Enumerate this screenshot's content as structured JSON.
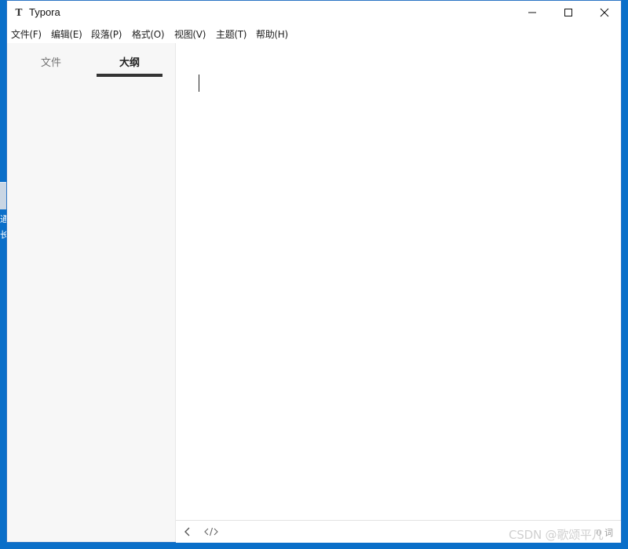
{
  "desktop": {
    "fragment_text": "通\n长"
  },
  "window": {
    "title": "Typora",
    "icon_glyph": "T",
    "controls": {
      "minimize_icon": "minimize-icon",
      "maximize_icon": "maximize-icon",
      "close_icon": "close-icon"
    }
  },
  "menu": {
    "items": [
      {
        "label": "文件(F)"
      },
      {
        "label": "编辑(E)"
      },
      {
        "label": "段落(P)"
      },
      {
        "label": "格式(O)"
      },
      {
        "label": "视图(V)"
      },
      {
        "label": "主题(T)"
      },
      {
        "label": "帮助(H)"
      }
    ]
  },
  "sidebar": {
    "tabs": [
      {
        "label": "文件",
        "active": false
      },
      {
        "label": "大纲",
        "active": true
      }
    ]
  },
  "editor": {
    "content": ""
  },
  "footer": {
    "back_icon": "chevron-left-icon",
    "source_icon": "code-icon",
    "word_count": "0 词"
  },
  "watermark": {
    "text": "CSDN @歌颂平凡"
  },
  "colors": {
    "desktop": "#0a6fc9",
    "window_border": "#2b74c4",
    "sidebar_bg": "#f7f7f7",
    "active_tab_underline": "#333333"
  }
}
